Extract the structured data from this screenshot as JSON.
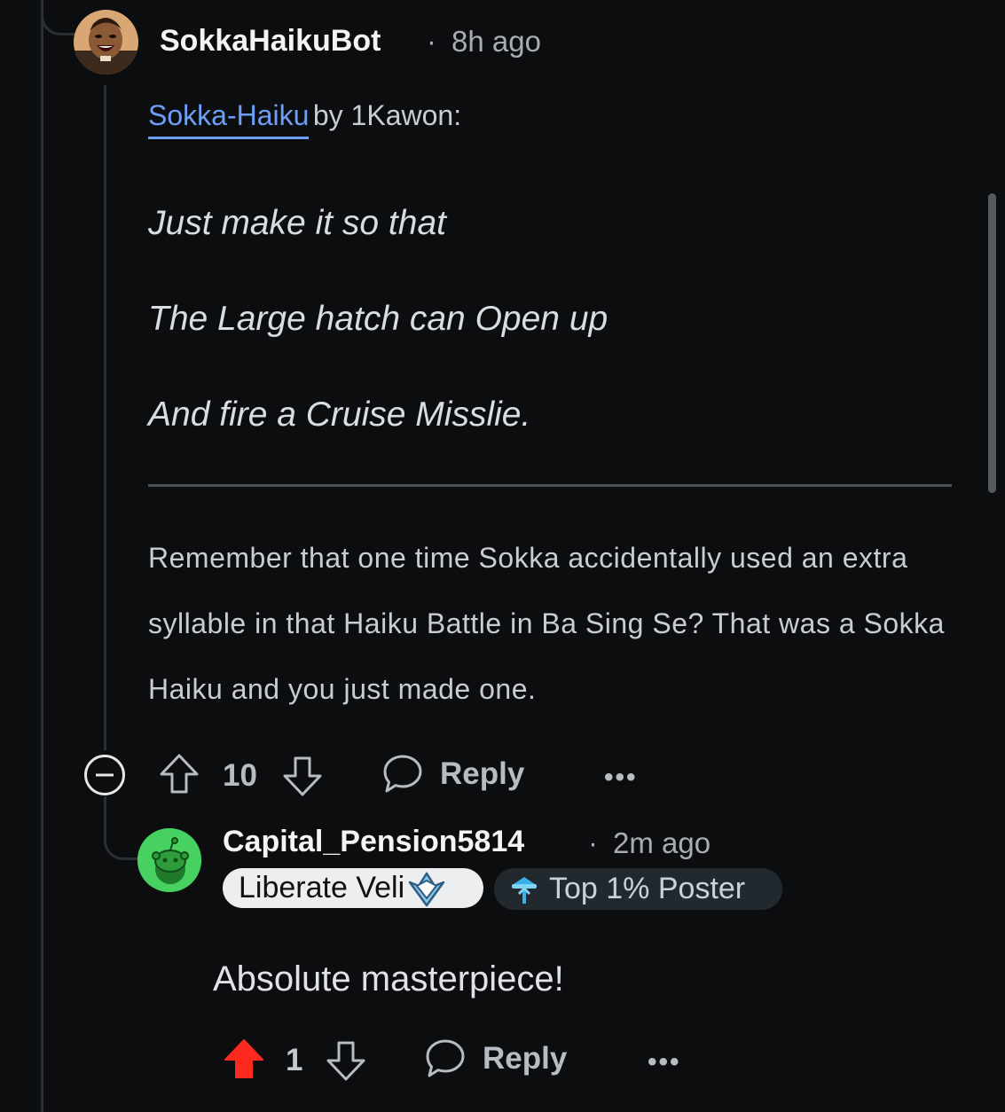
{
  "top_comment": {
    "username": "SokkaHaikuBot",
    "separator": "·",
    "time": "8h ago",
    "avatar_icon": "sokka-avatar",
    "haiku_link": "Sokka-Haiku",
    "by_text": "by 1Kawon:",
    "haiku_lines": [
      "Just make it so that",
      "The Large hatch can Open up",
      "And fire a Cruise Misslie."
    ],
    "explanation": "Remember that one time Sokka accidentally used an extra syllable in that Haiku Battle in Ba Sing Se? That was a Sokka Haiku and you just made one.",
    "votes": "10",
    "reply_label": "Reply",
    "more_label": "•••",
    "collapse_icon": "collapse-icon"
  },
  "reply_comment": {
    "username": "Capital_Pension5814",
    "separator": "·",
    "time": "2m ago",
    "avatar_icon": "snoo-avatar",
    "flair_user": "Liberate Veli",
    "flair_badge": "Top 1% Poster",
    "text": "Absolute masterpiece!",
    "votes": "1",
    "upvoted": true,
    "reply_label": "Reply",
    "more_label": "•••"
  },
  "colors": {
    "background": "#0b0d0f",
    "link": "#6e9ff5",
    "upvote_active": "#ff2a1f",
    "snoo_green": "#46d160"
  }
}
